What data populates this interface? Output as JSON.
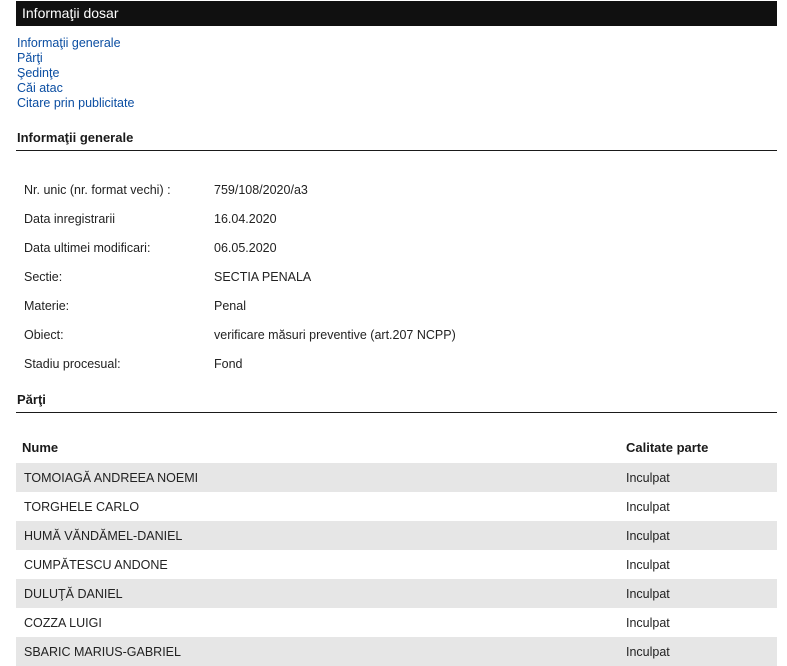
{
  "header": {
    "title": "Informaţii dosar"
  },
  "nav": {
    "items": [
      "Informaţii generale",
      "Părţi",
      "Şedinţe",
      "Căi atac",
      "Citare prin publicitate"
    ]
  },
  "info": {
    "title": "Informaţii generale",
    "rows": [
      {
        "label": "Nr. unic (nr. format vechi) :",
        "value": "759/108/2020/a3"
      },
      {
        "label": "Data inregistrarii",
        "value": "16.04.2020"
      },
      {
        "label": "Data ultimei modificari:",
        "value": "06.05.2020"
      },
      {
        "label": "Sectie:",
        "value": "SECTIA PENALA"
      },
      {
        "label": "Materie:",
        "value": "Penal"
      },
      {
        "label": "Obiect:",
        "value": "verificare măsuri preventive (art.207 NCPP)"
      },
      {
        "label": "Stadiu procesual:",
        "value": "Fond"
      }
    ]
  },
  "parti": {
    "title": "Părţi",
    "columns": [
      "Nume",
      "Calitate parte"
    ],
    "rows": [
      {
        "name": "TOMOIAGĂ ANDREEA NOEMI",
        "role": "Inculpat"
      },
      {
        "name": "TORGHELE CARLO",
        "role": "Inculpat"
      },
      {
        "name": "HUMĂ VĂNDĂMEL-DANIEL",
        "role": "Inculpat"
      },
      {
        "name": "CUMPĂTESCU ANDONE",
        "role": "Inculpat"
      },
      {
        "name": "DULUŢĂ DANIEL",
        "role": "Inculpat"
      },
      {
        "name": "COZZA LUIGI",
        "role": "Inculpat"
      },
      {
        "name": "SBARIC MARIUS-GABRIEL",
        "role": "Inculpat"
      }
    ]
  }
}
